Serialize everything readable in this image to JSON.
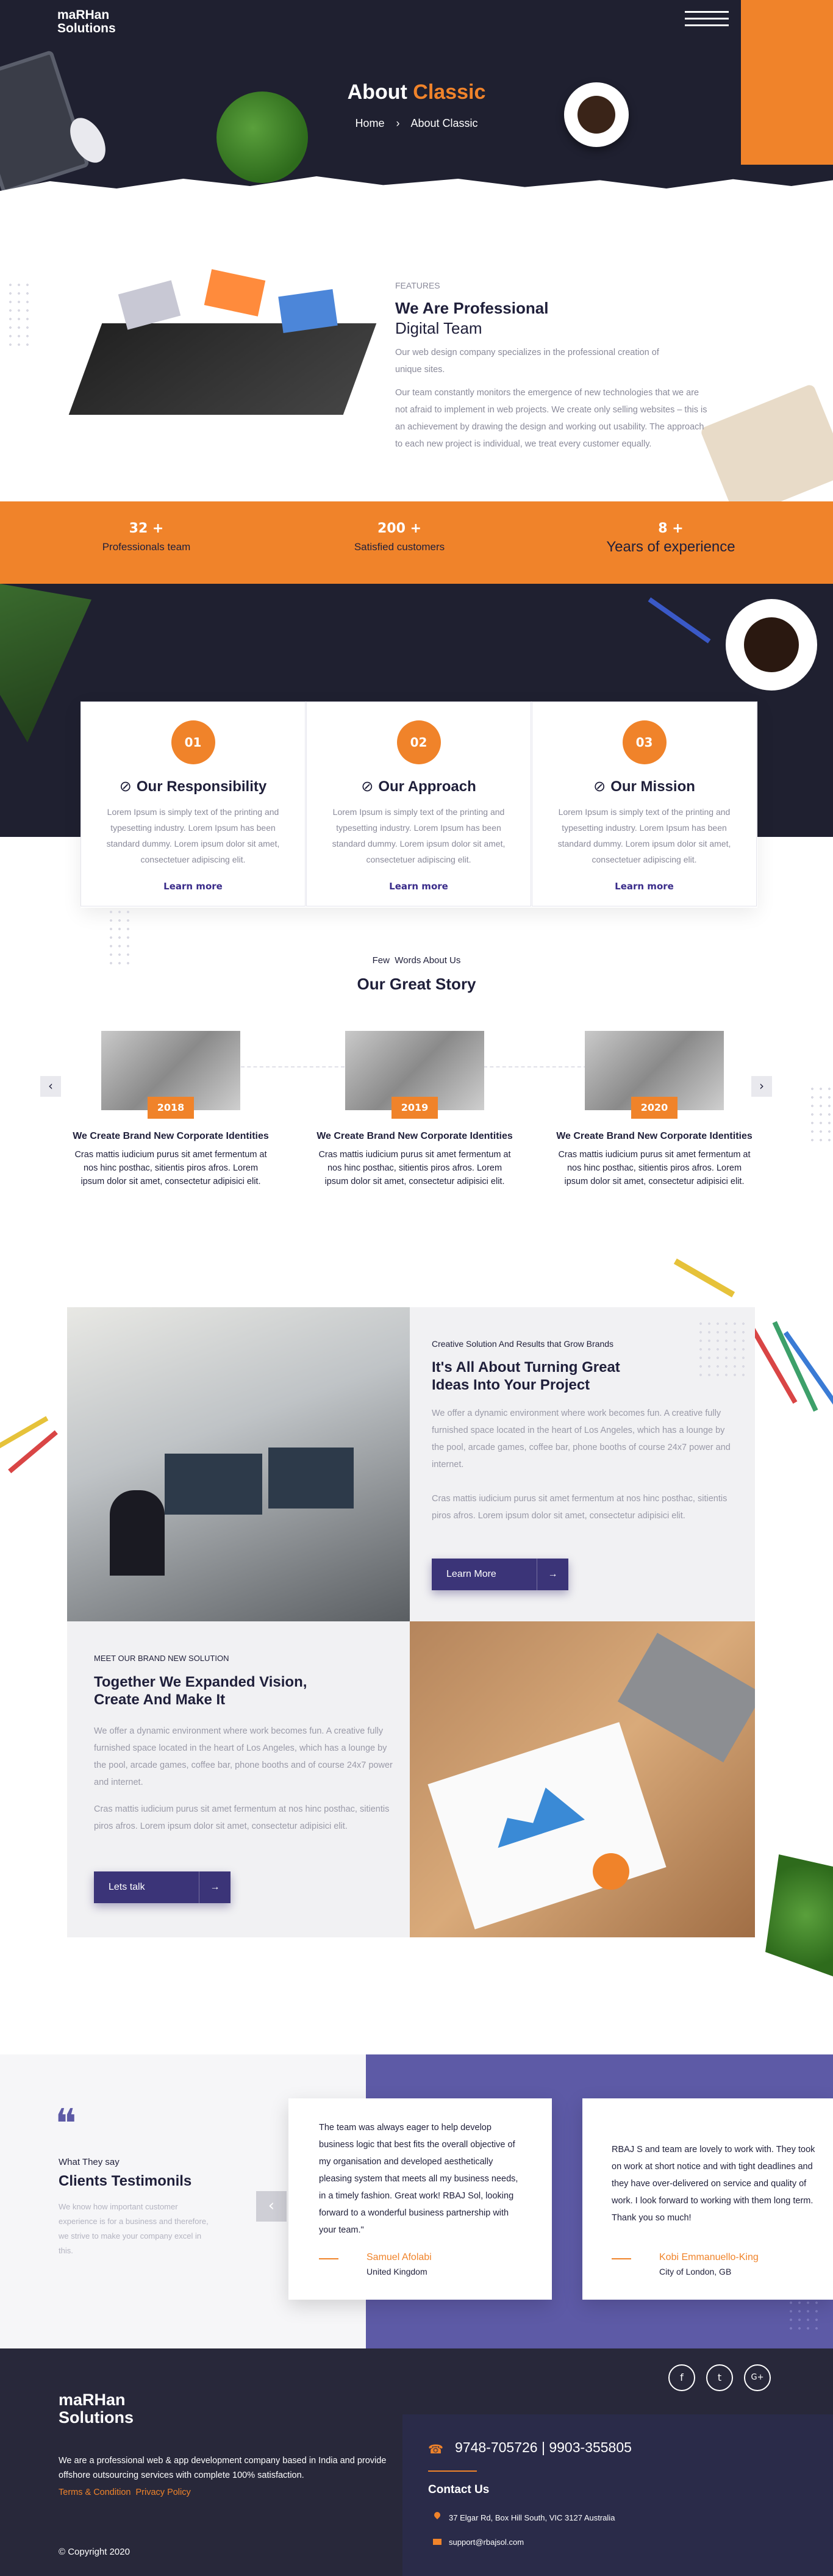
{
  "brand": {
    "line1": "maRHan",
    "line2": "Solutions"
  },
  "hero": {
    "title_a": "About ",
    "title_b": "Classic",
    "crumb_home": "Home",
    "crumb_sep": "›",
    "crumb_current": "About Classic"
  },
  "features": {
    "tag": "FEATURES",
    "heading_bold": "We Are Professional",
    "heading_light": "Digital Team",
    "p1": "Our web design company specializes in the professional creation of unique sites.",
    "p2": "Our team constantly monitors the emergence of new technologies that we are not afraid to implement in web projects. We create only selling websites – this is an achievement by drawing the design and working out usability. The approach to each new project is individual, we treat every customer equally."
  },
  "stats": [
    {
      "num": "32 +",
      "label": "Professionals team"
    },
    {
      "num": "200 +",
      "label": "Satisfied customers"
    },
    {
      "num": "8 +",
      "label": "Years of experience"
    }
  ],
  "cards": [
    {
      "num": "01",
      "title": "Our Responsibility",
      "text": "Lorem Ipsum is simply text of the printing and typesetting industry. Lorem Ipsum has been standard dummy. Lorem ipsum dolor sit amet, consectetuer adipiscing elit.",
      "more": "Learn more"
    },
    {
      "num": "02",
      "title": "Our Approach",
      "text": "Lorem Ipsum is simply text of the printing and typesetting industry. Lorem Ipsum has been standard dummy. Lorem ipsum dolor sit amet, consectetuer adipiscing elit.",
      "more": "Learn more"
    },
    {
      "num": "03",
      "title": "Our Mission",
      "text": "Lorem Ipsum is simply text of the printing and typesetting industry. Lorem Ipsum has been standard dummy. Lorem ipsum dolor sit amet, consectetuer adipiscing elit.",
      "more": "Learn more"
    }
  ],
  "story": {
    "kicker": "Few  Words About Us",
    "title": "Our Great Story",
    "prev": "‹",
    "next": "›",
    "items": [
      {
        "year": "2018",
        "title": "We Create Brand New Corporate Identities",
        "text": "Cras mattis iudicium purus sit amet fermentum at nos hinc posthac, sitientis piros afros. Lorem ipsum dolor sit amet, consectetur adipisici elit."
      },
      {
        "year": "2019",
        "title": "We Create Brand New Corporate Identities",
        "text": "Cras mattis iudicium purus sit amet fermentum at nos hinc posthac, sitientis piros afros. Lorem ipsum dolor sit amet, consectetur adipisici elit."
      },
      {
        "year": "2020",
        "title": "We Create Brand New Corporate Identities",
        "text": "Cras mattis iudicium purus sit amet fermentum at nos hinc posthac, sitientis piros afros. Lorem ipsum dolor sit amet, consectetur adipisici elit."
      }
    ]
  },
  "solution1": {
    "small": "Creative Solution And Results that Grow Brands",
    "heading": "It's All About Turning Great Ideas Into Your Project",
    "p1": "We offer a dynamic environment where work becomes fun. A creative fully furnished space located in the heart of Los Angeles, which has a lounge by the pool, arcade games, coffee bar, phone booths of course 24x7 power and internet.",
    "p2": "Cras mattis iudicium purus sit amet fermentum at nos hinc posthac, sitientis piros afros. Lorem ipsum dolor sit amet, consectetur adipisici elit.",
    "button": "Learn More",
    "arrow": "→"
  },
  "solution2": {
    "small": "MEET OUR BRAND NEW SOLUTION",
    "heading": "Together We Expanded Vision, Create And Make It",
    "p1": "We offer a dynamic environment where work becomes fun. A creative fully furnished space located in the heart of Los Angeles, which has a lounge by the pool, arcade games, coffee bar, phone booths and of course 24x7 power and internet.",
    "p2": "Cras mattis iudicium purus sit amet fermentum at nos hinc posthac, sitientis piros afros. Lorem ipsum dolor sit amet, consectetur adipisici elit.",
    "button": "Lets talk",
    "arrow": "→"
  },
  "testimonials": {
    "quote_mark": "❝",
    "kicker": "What They say",
    "title": "Clients Testimonils",
    "text": "We know how important customer experience is for a business and therefore, we strive to make your company excel in this.",
    "prev": "‹",
    "items": [
      {
        "text": "The team was always eager to help develop business logic that best fits the overall objective of my organisation and developed aesthetically pleasing system that meets all my business needs, in a timely fashion. Great work! RBAJ Sol, looking forward to a wonderful business partnership with your team.\"",
        "name": "Samuel Afolabi",
        "loc": "United Kingdom"
      },
      {
        "text": "RBAJ S and team are lovely to work with. They took on work at short notice and with tight deadlines and they have over-delivered on service and quality of work. I look forward to working with them long term. Thank you so much!",
        "name": "Kobi Emmanuello-King",
        "loc": "City of London, GB"
      }
    ]
  },
  "footer": {
    "about": "We are a professional web & app development company based in India and provide offshore outsourcing services with complete 100% satisfaction.",
    "terms": "Terms & Condition",
    "privacy": "Privacy Policy",
    "copyright": "© Copyright 2020",
    "phone": "9748-705726 | 9903-355805",
    "contact_title": "Contact Us",
    "address": "37 Elgar Rd, Box Hill South, VIC 3127 Australia",
    "email": "support@rbajsol.com",
    "social": [
      "f",
      "t",
      "G+"
    ]
  },
  "colors": {
    "orange": "#f0832a",
    "navy": "#1f2030",
    "purple": "#5d5aa6",
    "button": "#3b3478"
  }
}
